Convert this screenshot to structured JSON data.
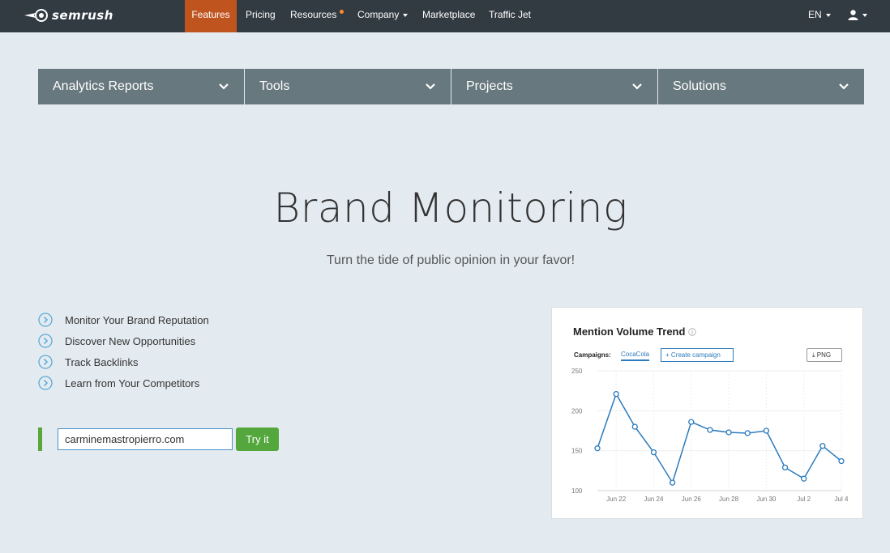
{
  "nav": {
    "logo": "semrush",
    "items": [
      {
        "label": "Features",
        "active": true,
        "caret": false,
        "dot": false
      },
      {
        "label": "Pricing",
        "active": false,
        "caret": false,
        "dot": false
      },
      {
        "label": "Resources",
        "active": false,
        "caret": false,
        "dot": true
      },
      {
        "label": "Company",
        "active": false,
        "caret": true,
        "dot": false
      },
      {
        "label": "Marketplace",
        "active": false,
        "caret": false,
        "dot": false
      },
      {
        "label": "Traffic Jet",
        "active": false,
        "caret": false,
        "dot": false
      }
    ],
    "language": "EN",
    "user_icon": "user-icon"
  },
  "dropdowns": [
    "Analytics Reports",
    "Tools",
    "Projects",
    "Solutions"
  ],
  "hero": {
    "title": "Brand Monitoring",
    "subtitle": "Turn the tide of public opinion in your favor!"
  },
  "features": [
    "Monitor Your Brand Reputation",
    "Discover New Opportunities",
    "Track Backlinks",
    "Learn from Your Competitors"
  ],
  "form": {
    "input_value": "carminemastropierro.com",
    "button_label": "Try it"
  },
  "card": {
    "title": "Mention Volume Trend",
    "campaigns_label": "Campaigns:",
    "campaign_tab": "CocaCola",
    "create_button": "+ Create campaign",
    "png_button": "⤓ PNG"
  },
  "colors": {
    "nav_bg": "#323a42",
    "nav_active": "#c0541f",
    "dropbar_bg": "#68787f",
    "page_bg": "#e4ebf0",
    "accent_blue": "#2b7bbd",
    "cta_green": "#54a73c"
  },
  "chart_data": {
    "type": "line",
    "title": "Mention Volume Trend",
    "x": [
      "Jun 21",
      "Jun 22",
      "Jun 23",
      "Jun 24",
      "Jun 25",
      "Jun 26",
      "Jun 27",
      "Jun 28",
      "Jun 29",
      "Jun 30",
      "Jul 1",
      "Jul 2",
      "Jul 3",
      "Jul 4"
    ],
    "series": [
      {
        "values": [
          153,
          221,
          180,
          148,
          110,
          186,
          176,
          173,
          172,
          175,
          129,
          115,
          156,
          137
        ]
      }
    ],
    "xticks": [
      "Jun 22",
      "Jun 24",
      "Jun 26",
      "Jun 28",
      "Jun 30",
      "Jul 2",
      "Jul 4"
    ],
    "yticks": [
      100,
      150,
      200,
      250
    ],
    "ylim": [
      100,
      250
    ],
    "grid": true,
    "line_color": "#2b7bbd"
  }
}
